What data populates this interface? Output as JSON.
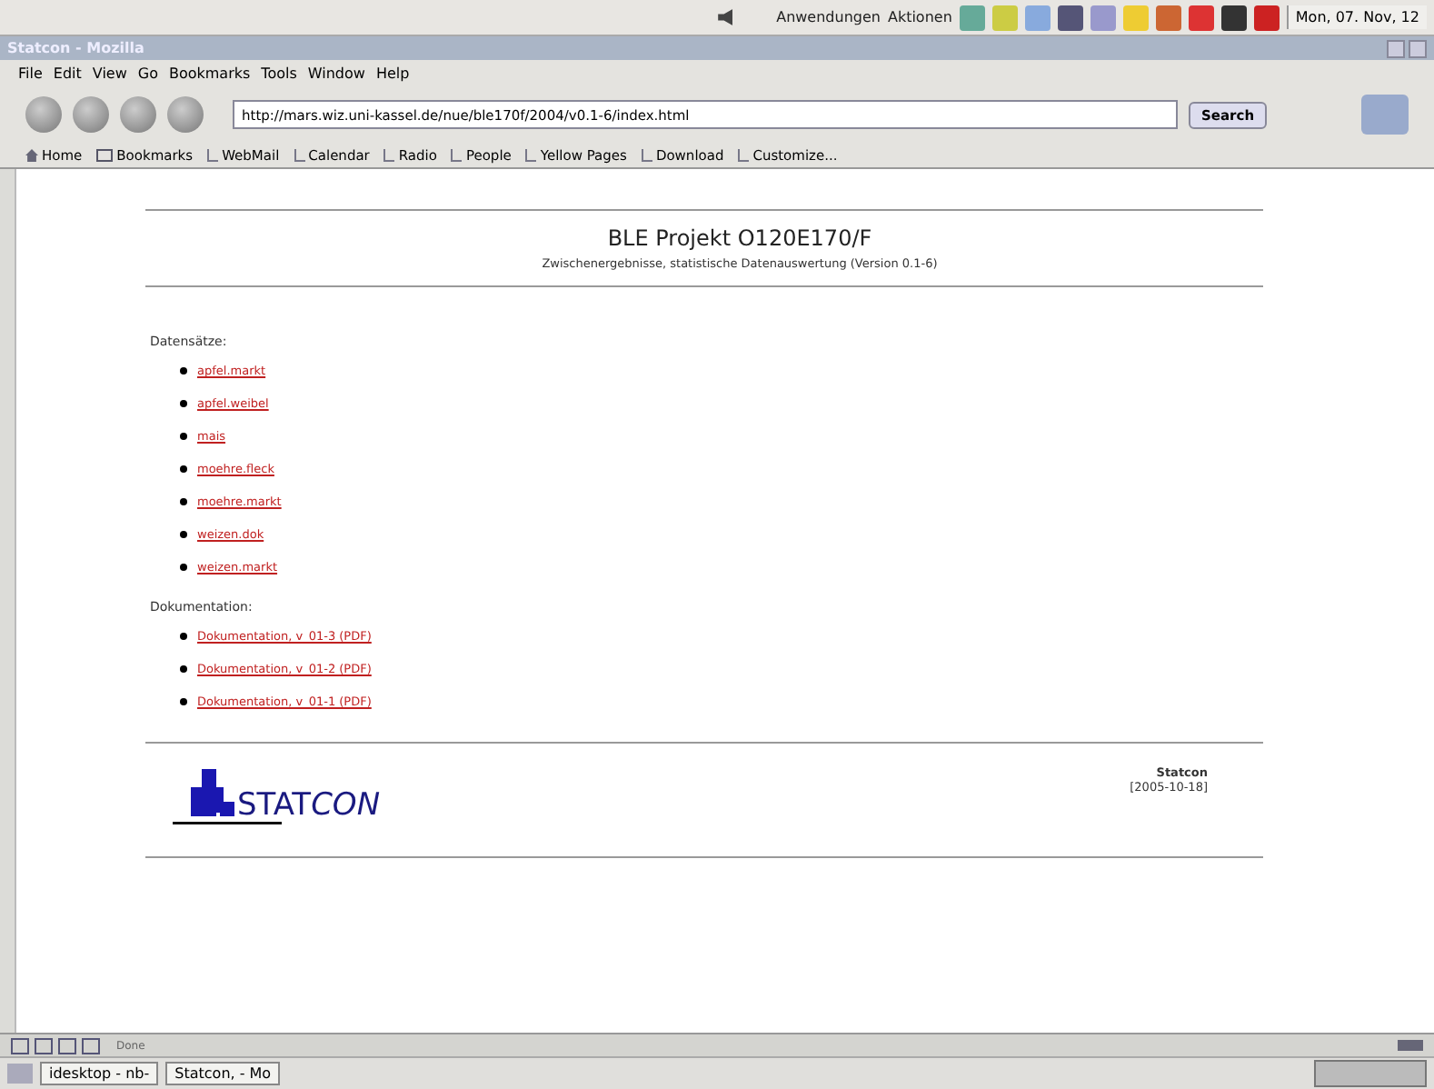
{
  "top_panel": {
    "menus": [
      "Anwendungen",
      "Aktionen"
    ],
    "clock": "Mon, 07. Nov, 12"
  },
  "window": {
    "title": "Statcon - Mozilla"
  },
  "menu_bar": [
    "File",
    "Edit",
    "View",
    "Go",
    "Bookmarks",
    "Tools",
    "Window",
    "Help"
  ],
  "nav_toolbar": {
    "url": "http://mars.wiz.uni-kassel.de/nue/ble170f/2004/v0.1-6/index.html",
    "search_button": "Search"
  },
  "bookmarks_bar": [
    {
      "label": "Home",
      "kind": "home"
    },
    {
      "label": "Bookmarks",
      "kind": "folder"
    },
    {
      "label": "WebMail",
      "kind": "link"
    },
    {
      "label": "Calendar",
      "kind": "link"
    },
    {
      "label": "Radio",
      "kind": "link"
    },
    {
      "label": "People",
      "kind": "link"
    },
    {
      "label": "Yellow Pages",
      "kind": "link"
    },
    {
      "label": "Download",
      "kind": "link"
    },
    {
      "label": "Customize...",
      "kind": "link"
    }
  ],
  "page": {
    "title": "BLE Projekt O120E170/F",
    "subtitle": "Zwischenergebnisse, statistische Datenauswertung (Version 0.1-6)",
    "sections": [
      {
        "heading": "Datensätze:",
        "links": [
          "apfel.markt",
          "apfel.weibel",
          "mais",
          "moehre.fleck",
          "moehre.markt",
          "weizen.dok",
          "weizen.markt"
        ]
      },
      {
        "heading": "Dokumentation:",
        "links": [
          "Dokumentation, v_01-3 (PDF)",
          "Dokumentation, v_01-2 (PDF)",
          "Dokumentation, v_01-1 (PDF)"
        ]
      }
    ],
    "footer": {
      "logo_text": "STAT",
      "logo_italic": "CON",
      "company": "Statcon",
      "date": "[2005-10-18]"
    }
  },
  "status_bar": {
    "text": "Done"
  },
  "taskbar": [
    "idesktop - nb-",
    "Statcon, - Mo"
  ]
}
